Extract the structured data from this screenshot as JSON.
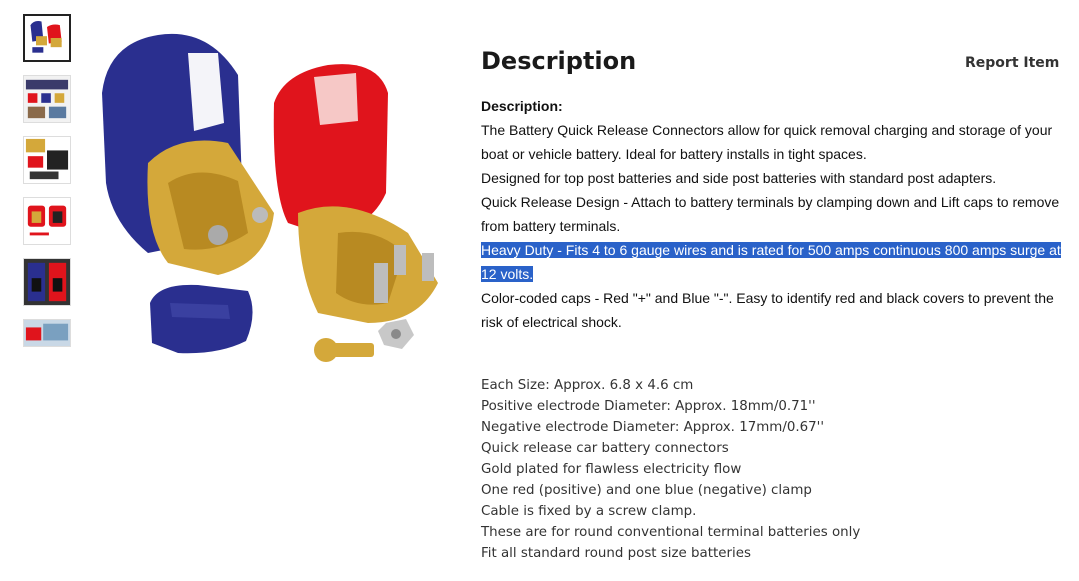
{
  "gallery": {
    "thumbnails": [
      {
        "name": "thumb-1",
        "active": true
      },
      {
        "name": "thumb-2",
        "active": false
      },
      {
        "name": "thumb-3",
        "active": false
      },
      {
        "name": "thumb-4",
        "active": false
      },
      {
        "name": "thumb-5",
        "active": false
      },
      {
        "name": "thumb-6",
        "active": false
      }
    ]
  },
  "description": {
    "title": "Description",
    "report_label": "Report Item",
    "section_label": "Description:",
    "paragraphs": [
      "The Battery Quick Release Connectors allow for quick removal charging and storage of your boat or vehicle battery. Ideal for battery installs in tight spaces.",
      "Designed for top post batteries and side post batteries with standard post adapters.",
      "Quick Release Design - Attach to battery terminals by clamping down and Lift caps to remove from battery terminals.",
      "Heavy Duty - Fits 4 to 6 gauge wires and is rated for 500 amps continuous 800 amps surge at 12 volts.",
      "Color-coded caps - Red \"+\" and Blue \"-\". Easy to identify red and black covers to prevent the risk of electrical shock."
    ],
    "specs": [
      "Each Size: Approx. 6.8 x 4.6 cm",
      "Positive electrode Diameter: Approx. 18mm/0.71''",
      "Negative electrode Diameter: Approx. 17mm/0.67''",
      "Quick release car battery connectors",
      "Gold plated for flawless electricity flow",
      "One red (positive) and one blue (negative) clamp",
      "Cable is fixed by a screw clamp.",
      "These are for round conventional terminal batteries only",
      "Fit all standard round post size batteries"
    ]
  },
  "colors": {
    "highlight": "#2a62c9",
    "red_cap": "#e0141c",
    "blue_cap": "#2a2f8f",
    "brass": "#d4a83a"
  }
}
